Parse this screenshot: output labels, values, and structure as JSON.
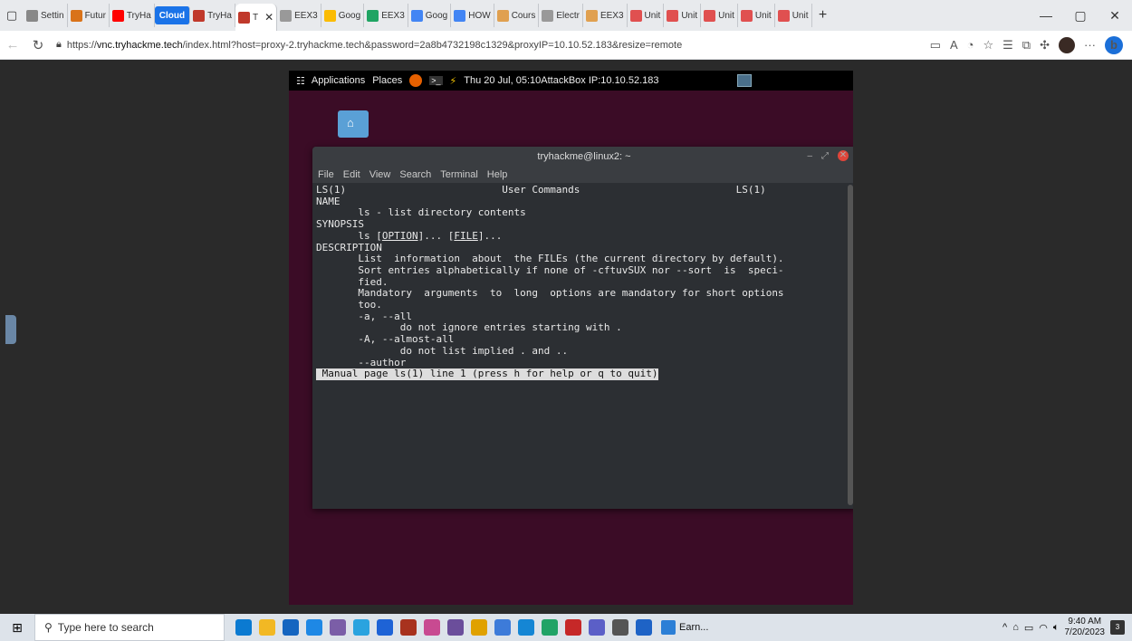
{
  "browser": {
    "tabs": [
      {
        "label": "Settin",
        "color": "#888888"
      },
      {
        "label": "Futur",
        "color": "#d9731a"
      },
      {
        "label": "TryHa",
        "color": "#ff0000"
      },
      {
        "label": "Cloud",
        "color": "#1a73e8"
      },
      {
        "label": "TryHa",
        "color": "#c0392b"
      },
      {
        "label": "T",
        "color": "#c0392b",
        "active": true
      },
      {
        "label": "EEX3",
        "color": "#999999"
      },
      {
        "label": "Goog",
        "color": "#fbbc04"
      },
      {
        "label": "EEX3",
        "color": "#1fa463"
      },
      {
        "label": "Goog",
        "color": "#4285f4"
      },
      {
        "label": "HOW",
        "color": "#4285f4"
      },
      {
        "label": "Cours",
        "color": "#e0a050"
      },
      {
        "label": "Electr",
        "color": "#999999"
      },
      {
        "label": "EEX3",
        "color": "#e0a050"
      },
      {
        "label": "Unit",
        "color": "#e05050"
      },
      {
        "label": "Unit",
        "color": "#e05050"
      },
      {
        "label": "Unit",
        "color": "#e05050"
      },
      {
        "label": "Unit",
        "color": "#e05050"
      },
      {
        "label": "Unit",
        "color": "#e05050"
      }
    ],
    "url_prefix": "https://",
    "url_host": "vnc.tryhackme.tech",
    "url_rest": "/index.html?host=proxy-2.tryhackme.tech&password=2a8b4732198c1329&proxyIP=10.10.52.183&resize=remote"
  },
  "gnome": {
    "applications": "Applications",
    "places": "Places",
    "datetime": "Thu 20 Jul, 05:10",
    "attackbox": "AttackBox IP:10.10.52.183"
  },
  "terminal": {
    "title": "tryhackme@linux2: ~",
    "menu": [
      "File",
      "Edit",
      "View",
      "Search",
      "Terminal",
      "Help"
    ],
    "lines": [
      "LS(1)                          User Commands                          LS(1)",
      "",
      "NAME",
      "       ls - list directory contents",
      "",
      "SYNOPSIS",
      "       ls [OPTION]... [FILE]...",
      "",
      "DESCRIPTION",
      "       List  information  about  the FILEs (the current directory by default).",
      "       Sort entries alphabetically if none of -cftuvSUX nor --sort  is  speci‐",
      "       fied.",
      "",
      "       Mandatory  arguments  to  long  options are mandatory for short options",
      "       too.",
      "",
      "       -a, --all",
      "              do not ignore entries starting with .",
      "",
      "       -A, --almost-all",
      "              do not list implied . and ..",
      "",
      "       --author"
    ],
    "status": " Manual page ls(1) line 1 (press h for help or q to quit)"
  },
  "taskbar": {
    "search_placeholder": "Type here to search",
    "earn_label": "Earn...",
    "time": "9:40 AM",
    "date": "7/20/2023",
    "notif_count": "3",
    "icon_colors": [
      "#0b7ad1",
      "#f2b824",
      "#1565c0",
      "#1e88e5",
      "#7b5ea7",
      "#2aa3df",
      "#1e63d6",
      "#a8321e",
      "#c84a91",
      "#6b4e9b",
      "#e0a100",
      "#3d7bd9",
      "#1586d4",
      "#21a366",
      "#c62828",
      "#5b5fc7",
      "#555555",
      "#1e63c6"
    ]
  }
}
